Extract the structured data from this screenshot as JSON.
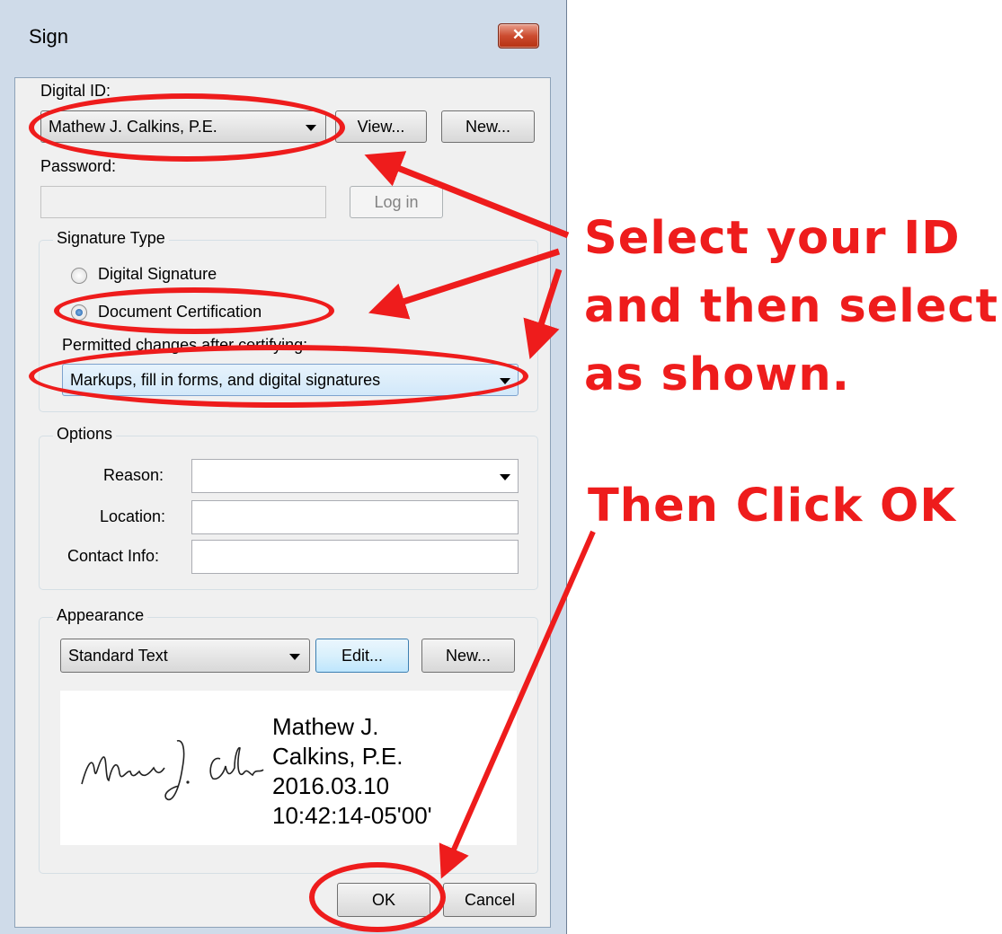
{
  "window": {
    "title": "Sign",
    "close_glyph": "✕"
  },
  "digital_id": {
    "label": "Digital ID:",
    "selected": "Mathew J. Calkins, P.E.",
    "view_button": "View...",
    "new_button": "New..."
  },
  "password": {
    "label": "Password:",
    "value": "",
    "login_button": "Log in"
  },
  "signature_type": {
    "group_title": "Signature Type",
    "options": [
      {
        "label": "Digital Signature",
        "checked": false
      },
      {
        "label": "Document Certification",
        "checked": true
      }
    ],
    "permitted_label": "Permitted changes after certifying:",
    "permitted_selected": "Markups, fill in forms, and digital signatures"
  },
  "options": {
    "group_title": "Options",
    "reason_label": "Reason:",
    "reason_value": "",
    "location_label": "Location:",
    "location_value": "",
    "contact_label": "Contact Info:",
    "contact_value": ""
  },
  "appearance": {
    "group_title": "Appearance",
    "selected": "Standard Text",
    "edit_button": "Edit...",
    "new_button": "New...",
    "preview_lines": [
      "Mathew J.",
      "Calkins, P.E.",
      "2016.03.10",
      "10:42:14-05'00'"
    ],
    "signature_script": "Mathew J. Calkins"
  },
  "footer": {
    "ok_button": "OK",
    "cancel_button": "Cancel"
  },
  "annotations": {
    "lines": [
      "Select your ID",
      "and then select",
      "as shown."
    ],
    "click_ok": "Then Click OK",
    "color": "#ee1c1c"
  }
}
